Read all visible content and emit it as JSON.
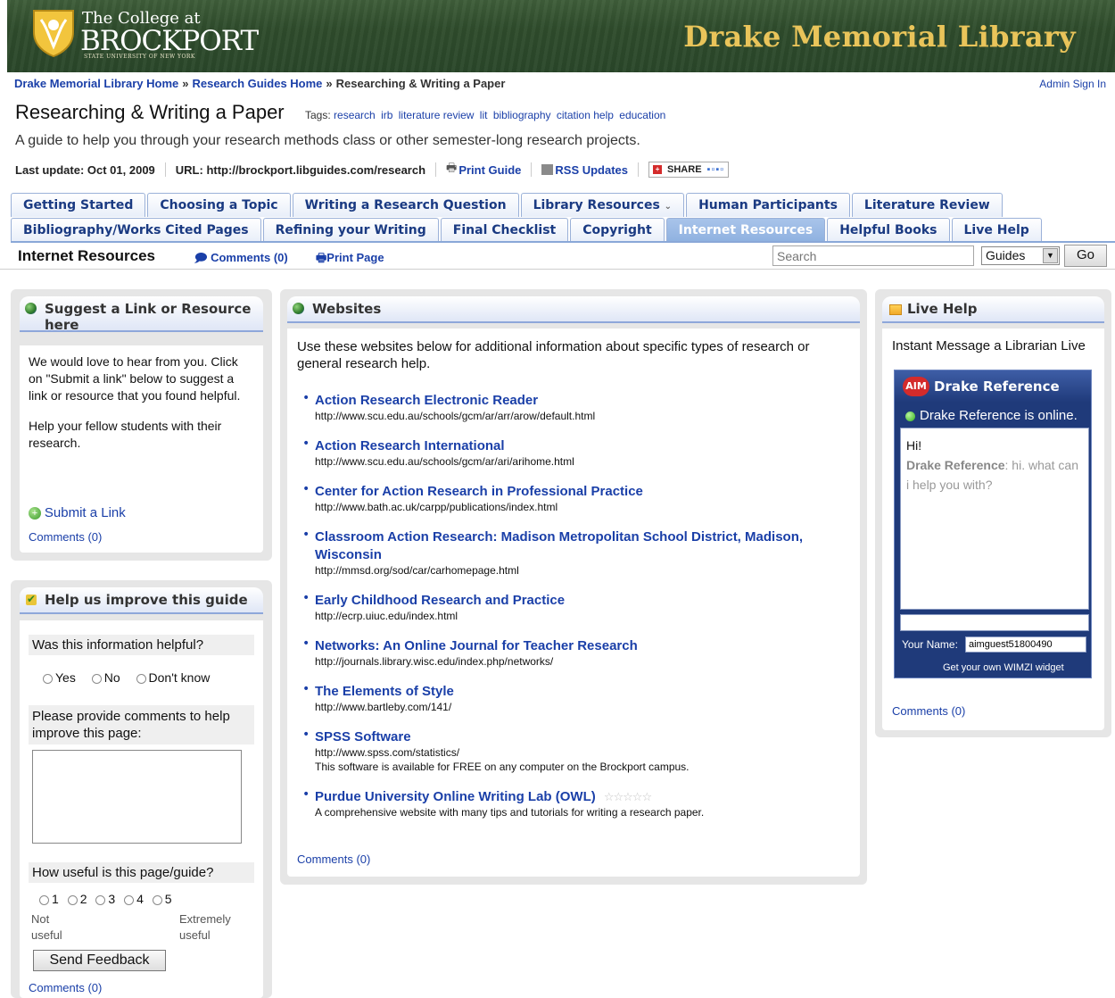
{
  "banner": {
    "college_small": "The College at",
    "college_big": "BROCKPORT",
    "college_tiny": "STATE UNIVERSITY OF NEW YORK",
    "library_title": "Drake Memorial Library"
  },
  "breadcrumb": {
    "items": [
      "Drake Memorial Library Home",
      "Research Guides Home"
    ],
    "separator": "»",
    "current": "Researching & Writing a Paper",
    "admin_sign_in": "Admin Sign In"
  },
  "guide": {
    "title": "Researching & Writing a Paper",
    "tags_label": "Tags:",
    "tags": [
      "research",
      "irb",
      "literature review",
      "lit",
      "bibliography",
      "citation help",
      "education"
    ],
    "description": "A guide to help you through your research methods class or other semester-long research projects.",
    "last_update": "Last update: Oct 01, 2009",
    "url": "URL: http://brockport.libguides.com/research",
    "print_guide": "Print Guide",
    "rss": "RSS Updates",
    "share": "SHARE"
  },
  "tabs": {
    "row1": [
      "Getting Started",
      "Choosing a Topic",
      "Writing a Research Question",
      "Library Resources",
      "Human Participants",
      "Literature Review"
    ],
    "row2": [
      "Bibliography/Works Cited Pages",
      "Refining your Writing",
      "Final Checklist",
      "Copyright",
      "Internet Resources",
      "Helpful Books",
      "Live Help"
    ],
    "active": "Internet Resources"
  },
  "subbar": {
    "title": "Internet Resources",
    "comments": "Comments (0)",
    "print_page": "Print Page",
    "search_placeholder": "Search",
    "scope": "Guides",
    "go": "Go"
  },
  "suggest_box": {
    "title": "Suggest a Link or Resource here",
    "p1": "We would love to hear from you. Click on \"Submit a link\" below to suggest a link or resource that you found helpful.",
    "p2": "Help your fellow students with their research.",
    "submit_link": "Submit a Link",
    "comments": "Comments (0)"
  },
  "feedback_box": {
    "title": "Help us improve this guide",
    "q1": "Was this information helpful?",
    "options": [
      "Yes",
      "No",
      "Don't know"
    ],
    "q2": "Please provide comments to help improve this page:",
    "q3": "How useful is this page/guide?",
    "scale": [
      "1",
      "2",
      "3",
      "4",
      "5"
    ],
    "scale_low": "Not useful",
    "scale_high": "Extremely useful",
    "send": "Send Feedback",
    "comments": "Comments (0)"
  },
  "websites_box": {
    "title": "Websites",
    "intro": "Use these websites below for additional information about specific types of research or general research help.",
    "sites": [
      {
        "title": "Action Research Electronic Reader",
        "url": "http://www.scu.edu.au/schools/gcm/ar/arr/arow/default.html"
      },
      {
        "title": "Action Research International",
        "url": "http://www.scu.edu.au/schools/gcm/ar/ari/arihome.html"
      },
      {
        "title": "Center for Action Research in Professional Practice",
        "url": "http://www.bath.ac.uk/carpp/publications/index.html"
      },
      {
        "title": "Classroom Action Research: Madison Metropolitan School District, Madison, Wisconsin",
        "url": "http://mmsd.org/sod/car/carhomepage.html"
      },
      {
        "title": "Early Childhood Research and Practice",
        "url": "http://ecrp.uiuc.edu/index.html"
      },
      {
        "title": "Networks: An Online Journal for Teacher Research",
        "url": "http://journals.library.wisc.edu/index.php/networks/"
      },
      {
        "title": "The Elements of Style",
        "url": "http://www.bartleby.com/141/"
      },
      {
        "title": "SPSS Software",
        "url": "http://www.spss.com/statistics/",
        "note": "This software is available for FREE on any computer on the Brockport campus."
      },
      {
        "title": "Purdue University Online Writing Lab (OWL)",
        "url": "",
        "note": "A comprehensive website with many tips and tutorials for writing a research paper.",
        "rating": 0
      }
    ],
    "comments": "Comments (0)"
  },
  "live_help_box": {
    "title": "Live Help",
    "intro": "Instant Message a Librarian Live",
    "aim_logo": "AIM",
    "aim_title": "Drake Reference",
    "status": "Drake Reference is online.",
    "chat_line1": "Hi!",
    "chat_who": "Drake Reference",
    "chat_msg": ": hi. what can i help you with?",
    "your_name_label": "Your Name:",
    "your_name_value": "aimguest51800490",
    "widget_footer": "Get your own WIMZI widget",
    "comments": "Comments (0)"
  }
}
